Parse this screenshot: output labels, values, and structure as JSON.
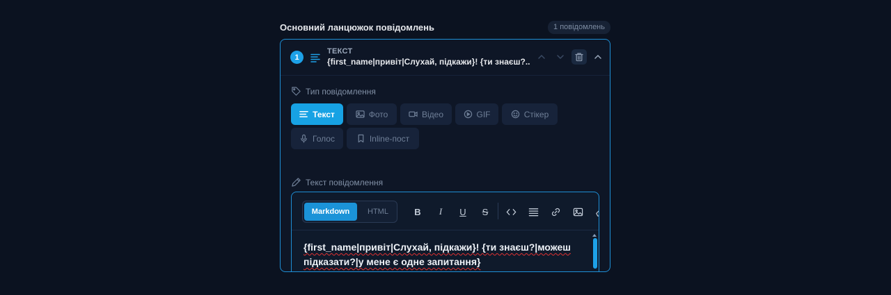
{
  "section": {
    "title": "Основний ланцюжок повідомлень",
    "count": "1 повідомлень"
  },
  "message": {
    "number": "1",
    "kind": "ТЕКСТ",
    "preview": "{first_name|привіт|Слухай, підкажи}! {ти знаєш?..."
  },
  "type_section": {
    "label": "Тип повідомлення",
    "types": [
      {
        "label": "Текст",
        "icon": "text-lines-icon",
        "active": true
      },
      {
        "label": "Фото",
        "icon": "image-icon",
        "active": false
      },
      {
        "label": "Відео",
        "icon": "video-icon",
        "active": false
      },
      {
        "label": "GIF",
        "icon": "play-circle-icon",
        "active": false
      },
      {
        "label": "Стікер",
        "icon": "smile-icon",
        "active": false
      },
      {
        "label": "Голос",
        "icon": "mic-icon",
        "active": false
      },
      {
        "label": "Inline-пост",
        "icon": "bookmark-icon",
        "active": false
      }
    ]
  },
  "text_section": {
    "label": "Текст повідомлення"
  },
  "editor": {
    "modes": [
      "Markdown",
      "HTML"
    ],
    "active_mode": "Markdown",
    "tools": [
      "B",
      "I",
      "U",
      "S"
    ],
    "content": "{first_name|привіт|Слухай, підкажи}! {ти знаєш?|можеш підказати?|у мене є одне запитання}"
  },
  "colors": {
    "accent": "#1da1e8",
    "background": "#0b1220",
    "card": "#0e1626",
    "border": "#1e8fd6"
  }
}
